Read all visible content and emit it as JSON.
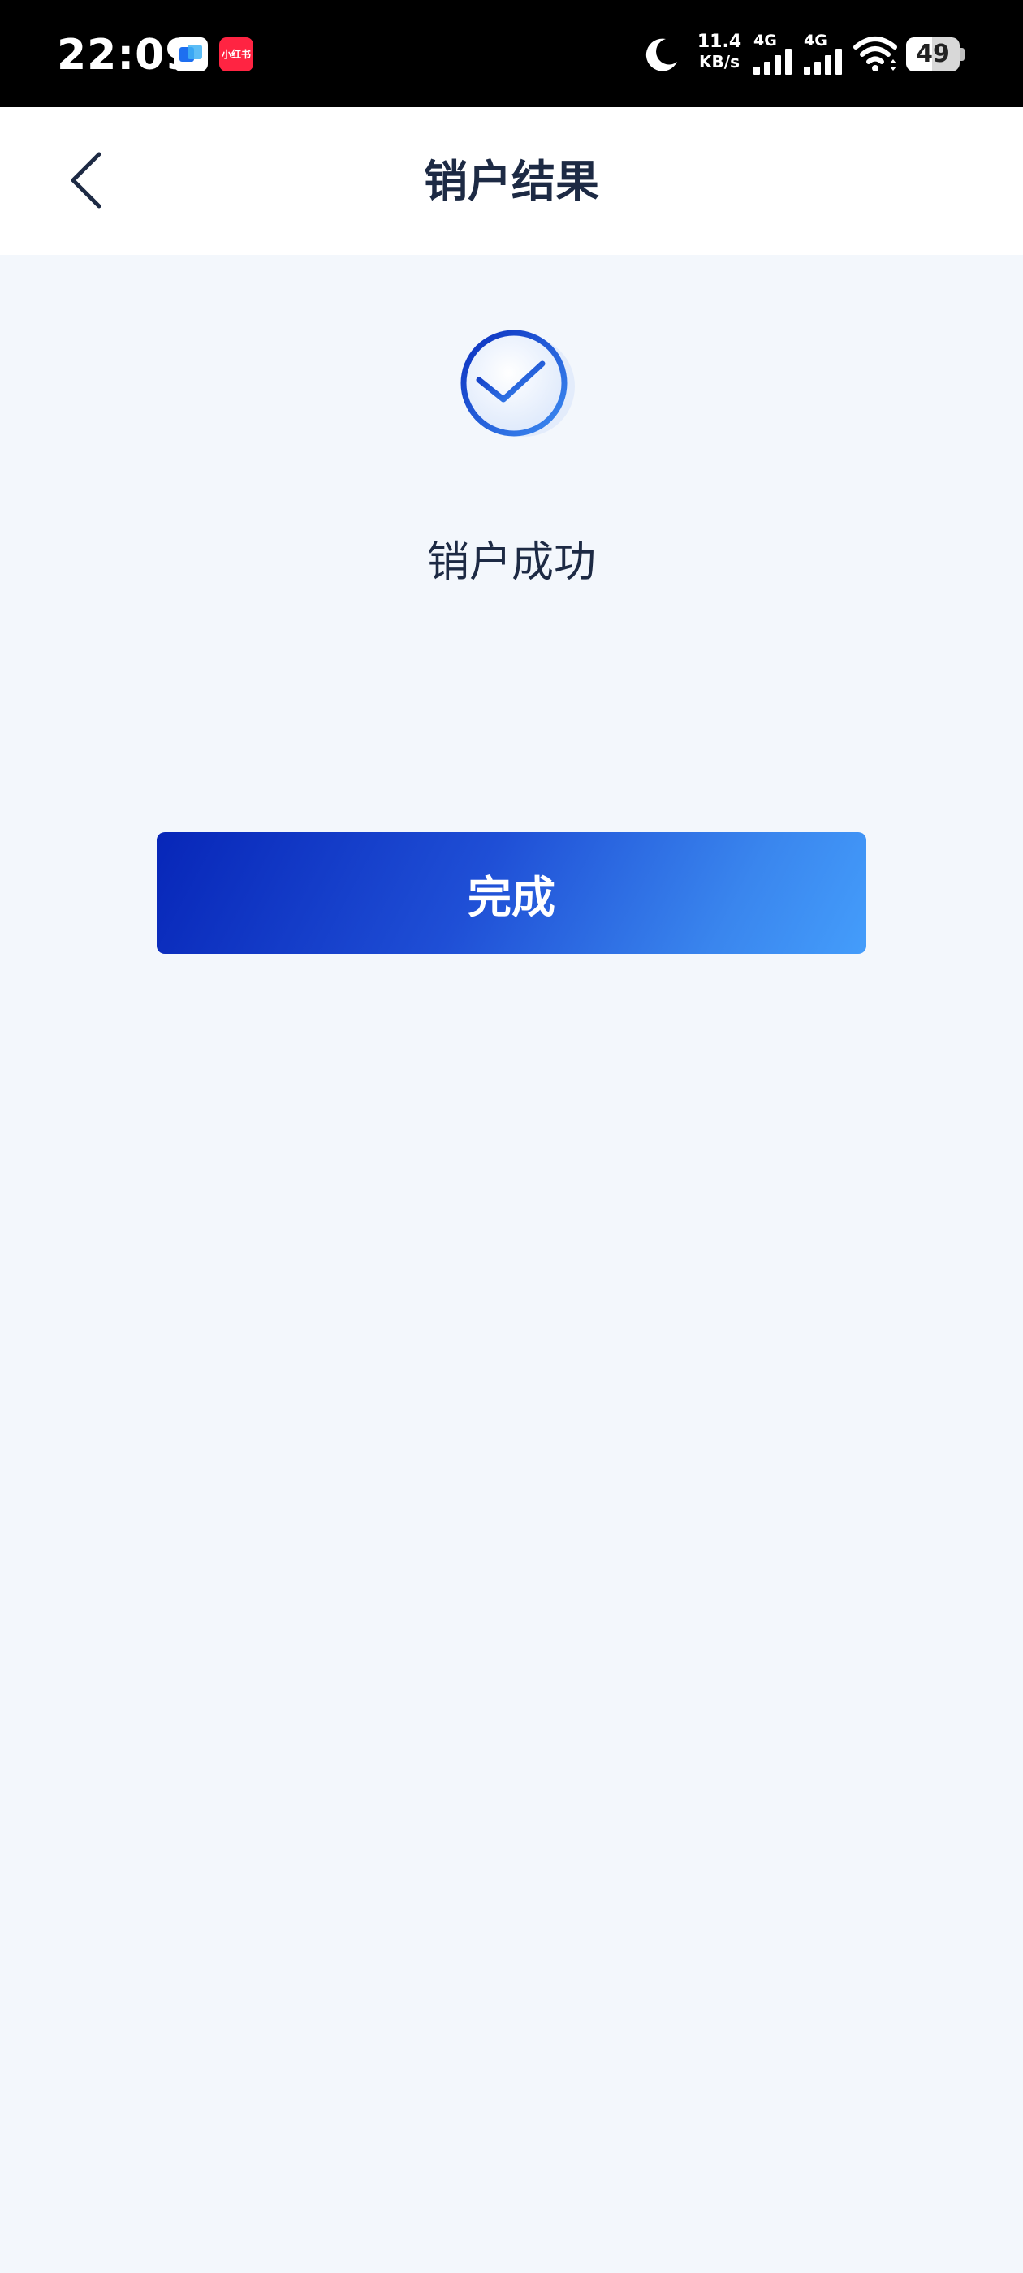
{
  "status_bar": {
    "time": "22:09",
    "app_badges": [
      {
        "icon": "blue-app-icon",
        "label": ""
      },
      {
        "icon": "xiaohongshu-icon",
        "label": "小红书"
      }
    ],
    "net_speed_value": "11.4",
    "net_speed_unit": "KB/s",
    "signal_1_label": "4G",
    "signal_2_label": "4G",
    "battery_level": "49",
    "battery_fraction": 0.49
  },
  "nav": {
    "title": "销户结果",
    "back_icon": "chevron-left-icon"
  },
  "result": {
    "icon": "check-circle-icon",
    "message": "销户成功"
  },
  "actions": {
    "done_label": "完成"
  },
  "colors": {
    "primary_start": "#0726b8",
    "primary_end": "#449dfb",
    "title_text": "#1d2a44",
    "page_background": "#f3f7fc"
  }
}
